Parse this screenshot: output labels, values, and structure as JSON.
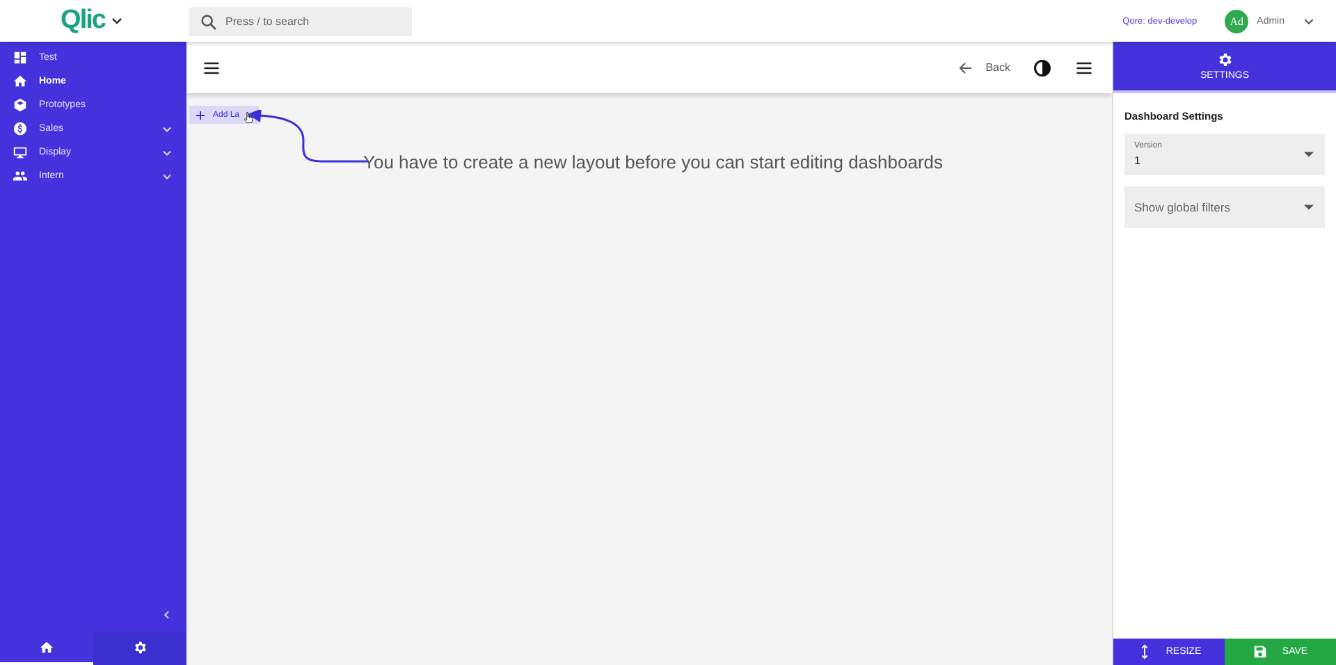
{
  "header": {
    "logo": "Qlic",
    "search": {
      "placeholder": "Press / to search"
    },
    "environment": "Qore: dev-develop",
    "avatar": "Ad",
    "user": "Admin"
  },
  "sidebar": {
    "items": [
      {
        "label": "Test",
        "selected": false,
        "expandable": false
      },
      {
        "label": "Home",
        "selected": true,
        "expandable": false
      },
      {
        "label": "Prototypes",
        "selected": false,
        "expandable": false
      },
      {
        "label": "Sales",
        "selected": false,
        "expandable": true
      },
      {
        "label": "Display",
        "selected": false,
        "expandable": true
      },
      {
        "label": "Intern",
        "selected": false,
        "expandable": true
      }
    ],
    "bottom_tabs": [
      {
        "selected": true
      },
      {
        "selected": false
      }
    ]
  },
  "toolbar": {
    "back": "Back"
  },
  "canvas": {
    "add_button": "Add La",
    "hint": "You have to create a new layout before you can start editing dashboards"
  },
  "settings_panel": {
    "tab": "SETTINGS",
    "heading": "Dashboard Settings",
    "fields": [
      {
        "label": "Version",
        "value": "1"
      },
      {
        "placeholder": "Show global filters"
      }
    ],
    "buttons": [
      {
        "label": "RESIZE",
        "kind": "resize"
      },
      {
        "label": "SAVE",
        "kind": "save"
      }
    ]
  }
}
